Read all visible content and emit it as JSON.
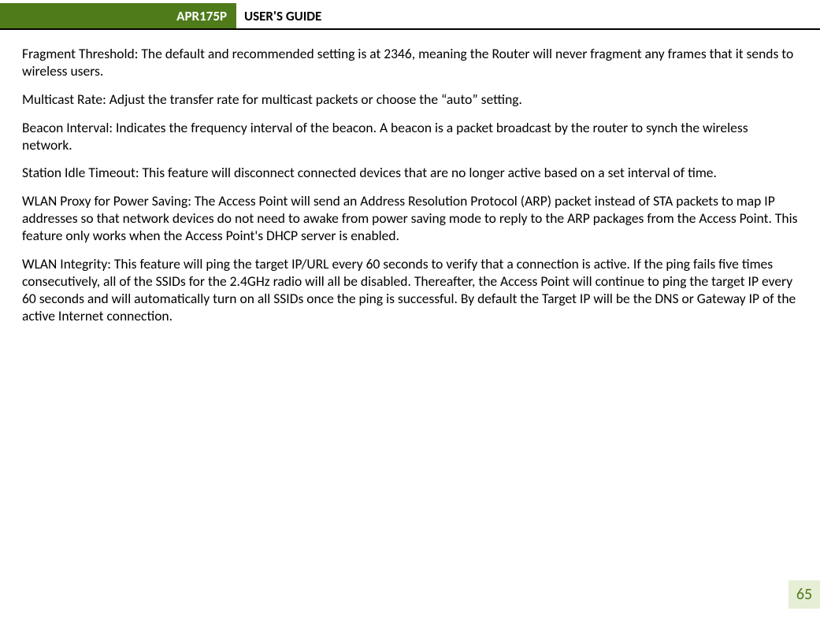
{
  "header": {
    "model": "APR175P",
    "title": "USER'S GUIDE"
  },
  "paragraphs": {
    "p1": "Fragment Threshold: The default and recommended setting is at 2346, meaning the Router will never fragment any frames that it sends to wireless users.",
    "p2": "Multicast Rate: Adjust the transfer rate for multicast packets or choose the “auto” setting.",
    "p3": "Beacon Interval: Indicates the frequency interval of the beacon. A beacon is a packet broadcast by the router to synch the wireless network.",
    "p4": "Station Idle Timeout: This feature will disconnect connected devices that are no longer active based on a set interval of time.",
    "p5": "WLAN Proxy for Power Saving: The Access Point will send an Address Resolution Protocol (ARP) packet instead of STA packets to map IP addresses so that network devices do not need to awake from power saving mode to reply to the ARP packages from the Access Point.  This feature only works when the Access Point's DHCP server is enabled.",
    "p6": "WLAN Integrity:  This feature will ping the target IP/URL every 60 seconds to verify that a connection is active.  If the ping fails five times consecutively, all of the SSIDs for the 2.4GHz radio will all be disabled.  Thereafter, the Access Point will continue to ping the target IP every 60 seconds and will automatically turn on all SSIDs once the ping is successful.  By default the Target IP will be the DNS or Gateway IP of the active Internet connection."
  },
  "page_number": "65"
}
